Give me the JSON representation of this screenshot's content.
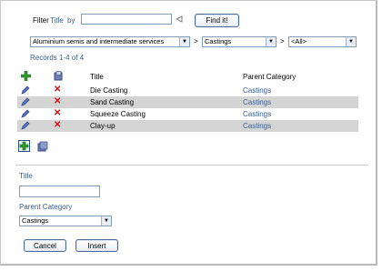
{
  "filter": {
    "label": "Filter",
    "field": "Title",
    "by": "by",
    "input_value": "",
    "find_label": "Find it!"
  },
  "selects": {
    "category": "Aluminium semis and intermediate services",
    "subcategory": "Castings",
    "third": "<All>",
    "separator": ">"
  },
  "records_text": "Records 1-4 of 4",
  "table": {
    "columns": [
      "Title",
      "Parent Category"
    ],
    "rows": [
      {
        "title": "Die Casting",
        "parent": "Castings"
      },
      {
        "title": "Sand Casting",
        "parent": "Castings"
      },
      {
        "title": "Squeeze Casting",
        "parent": "Castings"
      },
      {
        "title": "Clay-up",
        "parent": "Castings"
      }
    ]
  },
  "form": {
    "title_label": "Title",
    "title_value": "",
    "parent_label": "Parent Category",
    "parent_value": "Castings",
    "cancel_label": "Cancel",
    "insert_label": "Insert"
  },
  "colors": {
    "link": "#3a5f93",
    "delete": "#d01010",
    "alt_row": "#d4d4d4",
    "add_green": "#2e9a2e"
  }
}
